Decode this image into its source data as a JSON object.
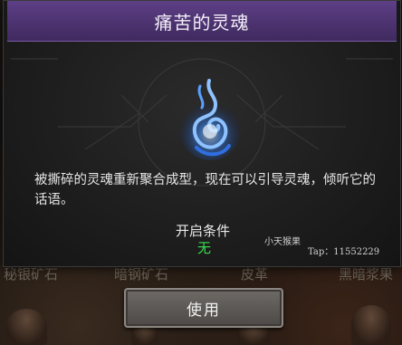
{
  "dialog": {
    "title": "痛苦的灵魂",
    "description": "被撕碎的灵魂重新聚合成型，现在可以引导灵魂，倾听它的话语。",
    "condition_label": "开启条件",
    "condition_value": "无",
    "use_label": "使用"
  },
  "watermark": {
    "name": "小天猴果",
    "tap": "Tap：11552229"
  },
  "background_items": [
    "秘银矿石",
    "暗钢矿石",
    "皮革",
    "黑暗浆果"
  ],
  "icons": [
    "soul-flame-icon"
  ],
  "colors": {
    "header": "#5d3f86",
    "condition_value": "#35e04a",
    "soul_flame": "#3c8cff"
  }
}
